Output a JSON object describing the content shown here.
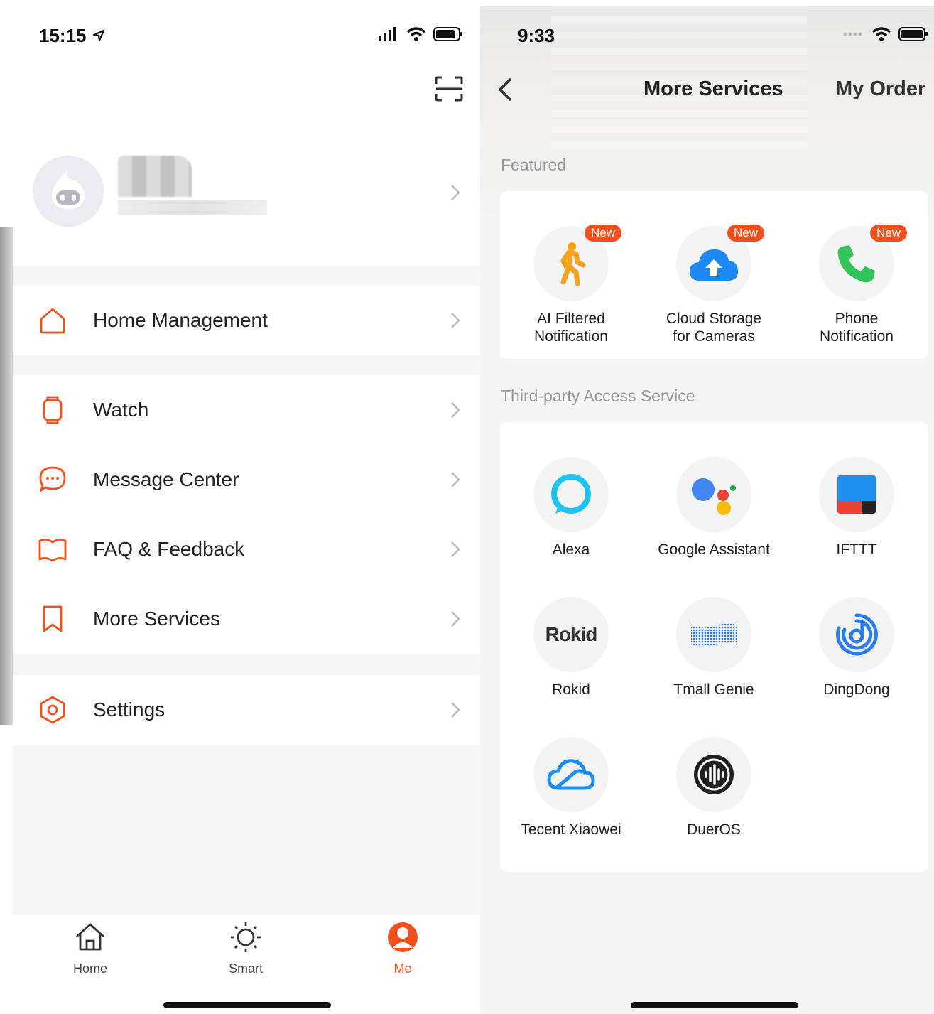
{
  "colors": {
    "accent": "#F4501E",
    "text": "#222222",
    "muted": "#999999"
  },
  "left": {
    "status_time": "15:15",
    "menu_group1": [
      {
        "label": "Home Management",
        "icon": "house-icon"
      }
    ],
    "menu_group2": [
      {
        "label": "Watch",
        "icon": "watch-icon"
      },
      {
        "label": "Message Center",
        "icon": "chat-bubble-icon"
      },
      {
        "label": "FAQ & Feedback",
        "icon": "book-icon"
      },
      {
        "label": "More Services",
        "icon": "bookmark-icon"
      }
    ],
    "menu_group3": [
      {
        "label": "Settings",
        "icon": "gear-hexagon-icon"
      }
    ],
    "tabs": [
      {
        "label": "Home",
        "icon": "home-icon",
        "active": false
      },
      {
        "label": "Smart",
        "icon": "sun-icon",
        "active": false
      },
      {
        "label": "Me",
        "icon": "person-icon",
        "active": true
      }
    ]
  },
  "right": {
    "status_time": "9:33",
    "title": "More Services",
    "my_order": "My Order",
    "featured_title": "Featured",
    "featured": [
      {
        "name": "AI Filtered\nNotification",
        "badge": "New",
        "icon": "walking-person-icon"
      },
      {
        "name": "Cloud Storage\nfor Cameras",
        "badge": "New",
        "icon": "cloud-upload-icon"
      },
      {
        "name": "Phone\nNotification",
        "badge": "New",
        "icon": "phone-icon"
      }
    ],
    "third_party_title": "Third-party Access Service",
    "third_party": [
      {
        "name": "Alexa",
        "icon": "alexa-icon"
      },
      {
        "name": "Google Assistant",
        "icon": "google-assistant-icon"
      },
      {
        "name": "IFTTT",
        "icon": "ifttt-icon"
      },
      {
        "name": "Rokid",
        "icon": "rokid-logo",
        "logo_text": "Rokid"
      },
      {
        "name": "Tmall Genie",
        "icon": "tmall-genie-icon"
      },
      {
        "name": "DingDong",
        "icon": "dingdong-icon"
      },
      {
        "name": "Tecent Xiaowei",
        "icon": "tencent-cloud-icon"
      },
      {
        "name": "DuerOS",
        "icon": "dueros-icon"
      }
    ]
  }
}
